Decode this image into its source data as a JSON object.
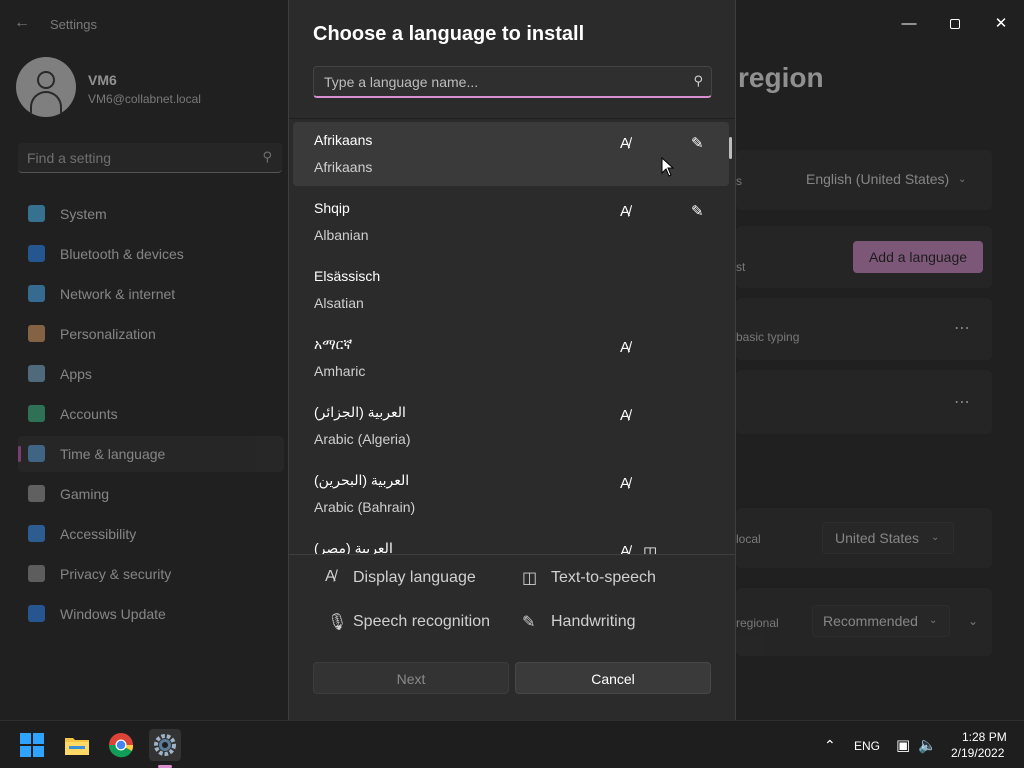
{
  "settings": {
    "app_title": "Settings",
    "user": {
      "name": "VM6",
      "email": "VM6@collabnet.local"
    },
    "search_placeholder": "Find a setting",
    "nav": [
      {
        "label": "System",
        "icon": "system-icon",
        "color": "#4cc2ff"
      },
      {
        "label": "Bluetooth & devices",
        "icon": "bluetooth-icon",
        "color": "#2a8cff"
      },
      {
        "label": "Network & internet",
        "icon": "network-icon",
        "color": "#4fb3ff"
      },
      {
        "label": "Personalization",
        "icon": "brush-icon",
        "color": "#e8a56b"
      },
      {
        "label": "Apps",
        "icon": "apps-icon",
        "color": "#7fb3d5"
      },
      {
        "label": "Accounts",
        "icon": "accounts-icon",
        "color": "#3ec28f"
      },
      {
        "label": "Time & language",
        "icon": "globe-clock-icon",
        "color": "#5ea8e8",
        "selected": true
      },
      {
        "label": "Gaming",
        "icon": "gaming-icon",
        "color": "#a0a0a0"
      },
      {
        "label": "Accessibility",
        "icon": "accessibility-icon",
        "color": "#3a9bff"
      },
      {
        "label": "Privacy & security",
        "icon": "shield-icon",
        "color": "#9a9a9a"
      },
      {
        "label": "Windows Update",
        "icon": "update-icon",
        "color": "#2e8bff"
      }
    ],
    "page_title_partial": "region",
    "windows_display_language": "English (United States)",
    "add_language_label": "Add a language",
    "card_partial_s": "s",
    "card_partial_st": "st",
    "card_partial_basic_typing": "basic typing",
    "card_partial_local": "local",
    "country_value": "United States",
    "card_partial_regional": "regional",
    "regional_format_value": "Recommended"
  },
  "dialog": {
    "title": "Choose a language to install",
    "search_placeholder": "Type a language name...",
    "languages": [
      {
        "native": "Afrikaans",
        "english": "Afrikaans",
        "display": true,
        "tts": false,
        "handwriting": true
      },
      {
        "native": "Shqip",
        "english": "Albanian",
        "display": true,
        "tts": false,
        "handwriting": true
      },
      {
        "native": "Elsässisch",
        "english": "Alsatian",
        "display": false,
        "tts": false,
        "handwriting": false
      },
      {
        "native": "አማርኛ",
        "english": "Amharic",
        "display": true,
        "tts": false,
        "handwriting": false
      },
      {
        "native": "العربية (الجزائر)",
        "english": "Arabic (Algeria)",
        "display": true,
        "tts": false,
        "handwriting": false
      },
      {
        "native": "العربية (البحرين)",
        "english": "Arabic (Bahrain)",
        "display": true,
        "tts": false,
        "handwriting": false
      },
      {
        "native": "العربية (مصر)",
        "english": "",
        "display": true,
        "tts": true,
        "handwriting": false
      }
    ],
    "legend": {
      "display_language": "Display language",
      "text_to_speech": "Text-to-speech",
      "speech_recognition": "Speech recognition",
      "handwriting": "Handwriting"
    },
    "next_label": "Next",
    "cancel_label": "Cancel"
  },
  "taskbar": {
    "language": "ENG",
    "time": "1:28 PM",
    "date": "2/19/2022"
  },
  "accent_color": "#d88fd0"
}
